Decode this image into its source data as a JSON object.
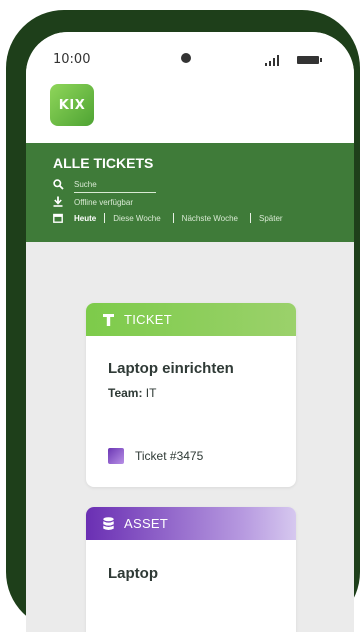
{
  "status_bar": {
    "time": "10:00"
  },
  "app": {
    "logo_text": "KIX",
    "accent": "#3f7b39"
  },
  "header": {
    "title": "ALLE TICKETS",
    "search_placeholder": "Suche",
    "offline_label": "Offline verfügbar",
    "date_tabs": [
      {
        "label": "Heute",
        "active": true
      },
      {
        "label": "Diese Woche",
        "active": false
      },
      {
        "label": "Nächste Woche",
        "active": false
      },
      {
        "label": "Später",
        "active": false
      }
    ]
  },
  "cards": [
    {
      "type_label": "TICKET",
      "type_icon": "ticket-t-icon",
      "title": "Laptop einrichten",
      "team_label": "Team:",
      "team_value": "IT",
      "reference_label": "Ticket #3475",
      "color": "#7dcb4a"
    },
    {
      "type_label": "ASSET",
      "type_icon": "database-icon",
      "title": "Laptop",
      "color": "#6a2fb3"
    }
  ]
}
